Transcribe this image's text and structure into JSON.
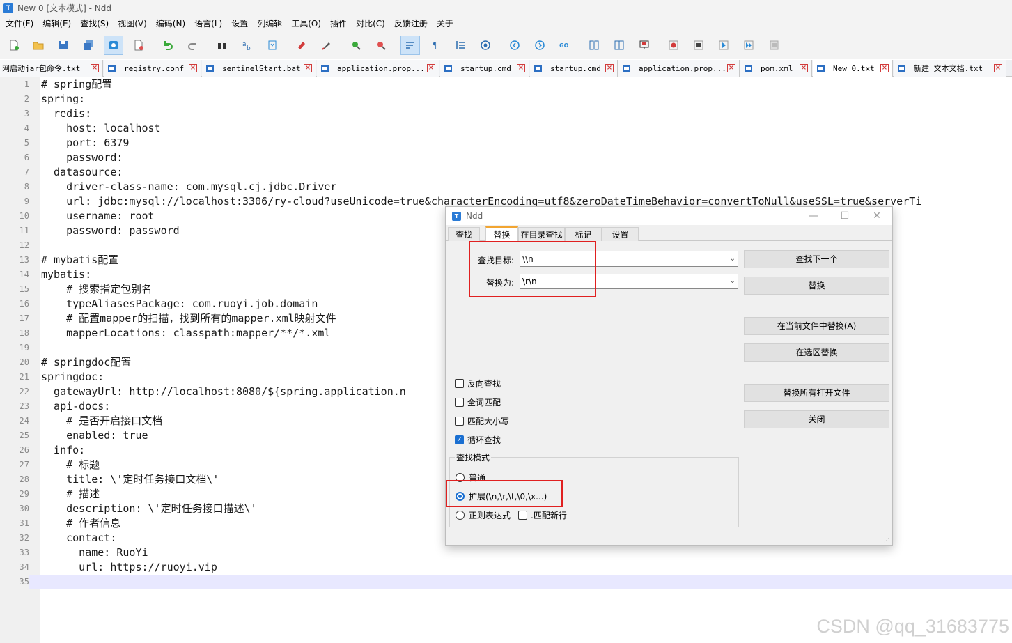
{
  "window": {
    "title": "New 0 [文本模式] - Ndd",
    "app_icon": "T"
  },
  "menu": [
    "文件(F)",
    "编辑(E)",
    "查找(S)",
    "视图(V)",
    "编码(N)",
    "语言(L)",
    "设置",
    "列编辑",
    "工具(O)",
    "插件",
    "对比(C)",
    "反馈注册",
    "关于"
  ],
  "toolbar": {
    "icons": [
      "new-file-icon",
      "open-folder-icon",
      "save-icon",
      "save-all-icon",
      "file-mode-icon",
      "close-file-icon",
      "undo-icon",
      "redo-icon",
      "find-icon",
      "replace-icon",
      "bookmark-icon",
      "clear-icon",
      "brush-icon",
      "zoom-in-icon",
      "zoom-out-icon",
      "word-wrap-icon",
      "show-symbols-icon",
      "indent-guide-icon",
      "target-icon",
      "prev-icon",
      "next-icon",
      "goto-icon",
      "compare-icon",
      "split-icon",
      "monitor-icon",
      "record-icon",
      "stop-icon",
      "play-icon",
      "play-multiple-icon",
      "save-macro-icon"
    ]
  },
  "tabs": [
    "网启动jar包命令.txt",
    "registry.conf",
    "sentinelStart.bat",
    "application.prop...",
    "startup.cmd",
    "startup.cmd",
    "application.prop...",
    "pom.xml",
    "New 0.txt",
    "新建 文本文档.txt"
  ],
  "editor": {
    "lines": [
      "# spring配置",
      "spring:",
      "  redis:",
      "    host: localhost",
      "    port: 6379",
      "    password:",
      "  datasource:",
      "    driver-class-name: com.mysql.cj.jdbc.Driver",
      "    url: jdbc:mysql://localhost:3306/ry-cloud?useUnicode=true&characterEncoding=utf8&zeroDateTimeBehavior=convertToNull&useSSL=true&serverTi",
      "    username: root",
      "    password: password",
      "",
      "# mybatis配置",
      "mybatis:",
      "    # 搜索指定包别名",
      "    typeAliasesPackage: com.ruoyi.job.domain",
      "    # 配置mapper的扫描，找到所有的mapper.xml映射文件",
      "    mapperLocations: classpath:mapper/**/*.xml",
      "",
      "# springdoc配置",
      "springdoc:",
      "  gatewayUrl: http://localhost:8080/${spring.application.n",
      "  api-docs:",
      "    # 是否开启接口文档",
      "    enabled: true",
      "  info:",
      "    # 标题",
      "    title: \\'定时任务接口文档\\'",
      "    # 描述",
      "    description: \\'定时任务接口描述\\'",
      "    # 作者信息",
      "    contact:",
      "      name: RuoYi",
      "      url: https://ruoyi.vip",
      ""
    ],
    "line_numbers": [
      "1",
      "2",
      "3",
      "4",
      "5",
      "6",
      "7",
      "8",
      "9",
      "10",
      "11",
      "12",
      "13",
      "14",
      "15",
      "16",
      "17",
      "18",
      "19",
      "20",
      "21",
      "22",
      "23",
      "24",
      "25",
      "26",
      "27",
      "28",
      "29",
      "30",
      "31",
      "32",
      "33",
      "34",
      "35"
    ]
  },
  "dialog": {
    "title": "Ndd",
    "tabs": [
      "查找",
      "替换",
      "在目录查找",
      "标记",
      "设置"
    ],
    "active_tab": "替换",
    "find_label": "查找目标:",
    "find_value": "\\\\n",
    "replace_label": "替换为:",
    "replace_value": "\\r\\n",
    "buttons": {
      "find_next": "查找下一个",
      "replace": "替换",
      "replace_in_file": "在当前文件中替换(A)",
      "replace_in_selection": "在选区替换",
      "replace_all_open": "替换所有打开文件",
      "close": "关闭"
    },
    "options": {
      "reverse": {
        "label": "反向查找",
        "checked": false
      },
      "whole_word": {
        "label": "全词匹配",
        "checked": false
      },
      "match_case": {
        "label": "匹配大小写",
        "checked": false
      },
      "wrap": {
        "label": "循环查找",
        "checked": true
      }
    },
    "mode_group": "查找模式",
    "modes": {
      "normal": "普通",
      "extended": "扩展(\\n,\\r,\\t,\\0,\\x...)",
      "regex": "正则表达式",
      "dot_newline": ".匹配新行"
    },
    "selected_mode": "extended"
  },
  "watermark": "CSDN @qq_31683775",
  "colors": {
    "highlight_red": "#e02020",
    "accent_blue": "#1a6fd1",
    "tab_active": "#f2a531"
  }
}
